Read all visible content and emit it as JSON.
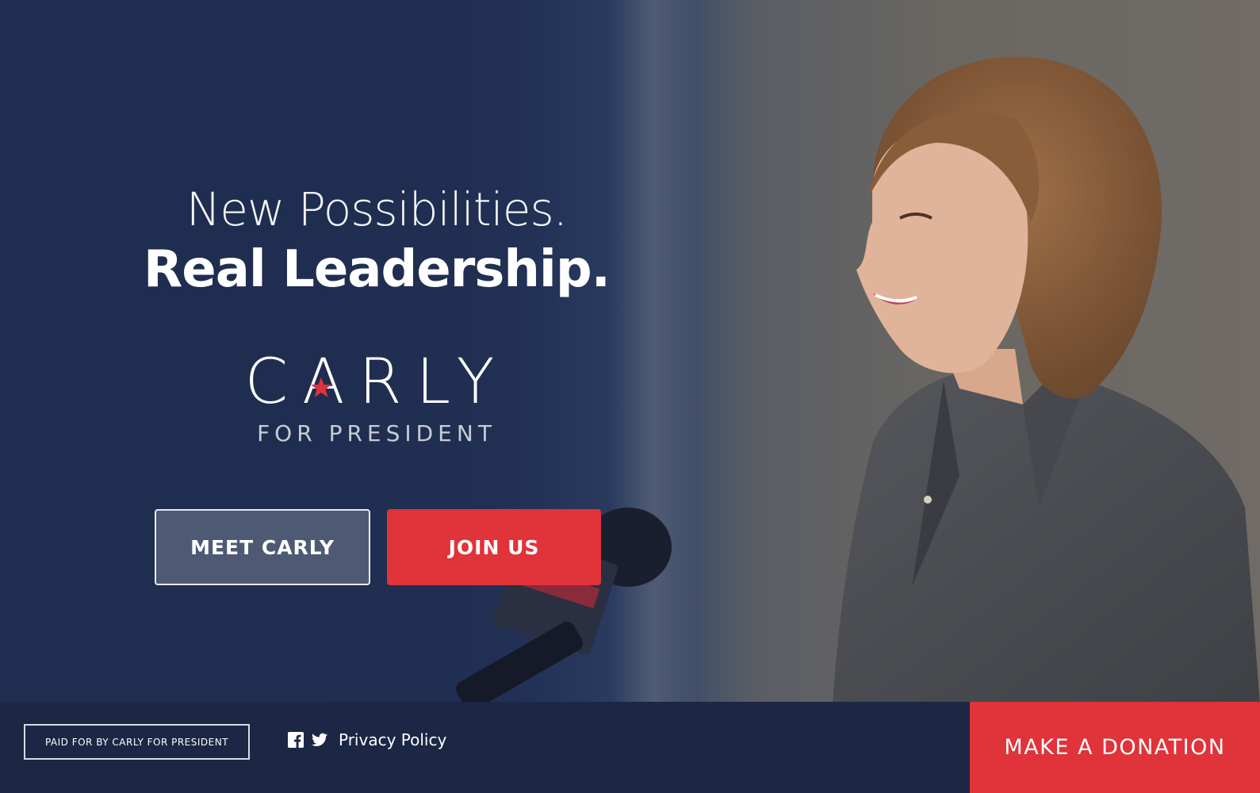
{
  "headline": {
    "line1": "New Possibilities.",
    "line2": "Real Leadership."
  },
  "logo": {
    "name": "CARLY",
    "tagline": "FOR PRESIDENT",
    "star_color": "#e0333a"
  },
  "buttons": {
    "meet": "MEET CARLY",
    "join": "JOIN US"
  },
  "footer": {
    "disclaimer": "PAID FOR BY CARLY FOR PRESIDENT",
    "social_icons": [
      "facebook-icon",
      "twitter-icon"
    ],
    "privacy": "Privacy Policy",
    "donate": "MAKE A DONATION"
  },
  "colors": {
    "navy": "#1f2d50",
    "accent_red": "#e0333a",
    "footer": "#1c2745"
  }
}
